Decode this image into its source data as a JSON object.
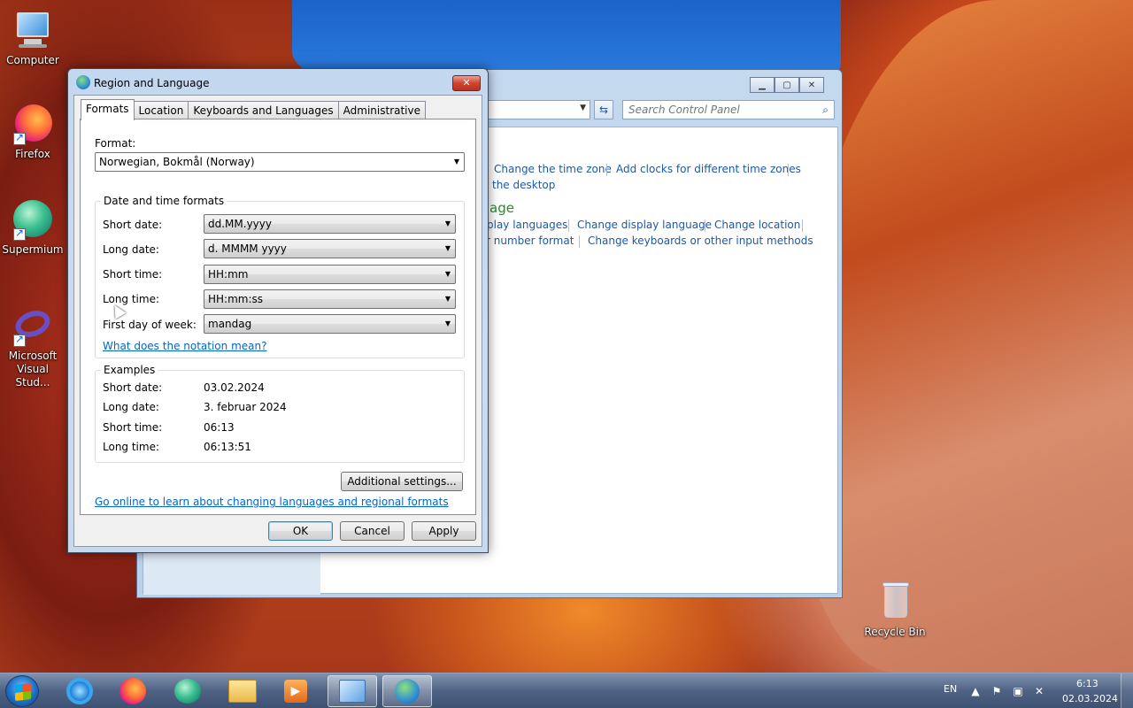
{
  "desktop": {
    "icons": [
      {
        "label": "Computer"
      },
      {
        "label": "Firefox"
      },
      {
        "label": "Supermium"
      },
      {
        "label": "Microsoft Visual Stud..."
      },
      {
        "label": "Recycle Bin"
      }
    ]
  },
  "control_panel": {
    "search_placeholder": "Search Control Panel",
    "links": {
      "change_time_zone": "Change the time zone",
      "add_clocks": "Add clocks for different time zones",
      "desktop_gadget": "the desktop",
      "heading_partial": "age",
      "display_languages_partial": "play languages",
      "change_display_language": "Change display language",
      "change_location": "Change location",
      "number_format_partial": "r number format",
      "change_keyboards": "Change keyboards or other input methods"
    }
  },
  "dialog": {
    "title": "Region and Language",
    "close_glyph": "✕",
    "tabs": [
      "Formats",
      "Location",
      "Keyboards and Languages",
      "Administrative"
    ],
    "active_tab": "Formats",
    "format_label": "Format:",
    "format_value": "Norwegian, Bokmål (Norway)",
    "datetime_group_title": "Date and time formats",
    "fields": [
      {
        "label": "Short date:",
        "value": "dd.MM.yyyy"
      },
      {
        "label": "Long date:",
        "value": "d. MMMM yyyy"
      },
      {
        "label": "Short time:",
        "value": "HH:mm"
      },
      {
        "label": "Long time:",
        "value": "HH:mm:ss"
      },
      {
        "label": "First day of week:",
        "value": "mandag"
      }
    ],
    "notation_link": "What does the notation mean?",
    "examples_group_title": "Examples",
    "examples": [
      {
        "label": "Short date:",
        "value": "03.02.2024"
      },
      {
        "label": "Long date:",
        "value": "3. februar 2024"
      },
      {
        "label": "Short time:",
        "value": "06:13"
      },
      {
        "label": "Long time:",
        "value": "06:13:51"
      }
    ],
    "additional_settings": "Additional settings...",
    "online_link": "Go online to learn about changing languages and regional formats",
    "ok": "OK",
    "cancel": "Cancel",
    "apply": "Apply"
  },
  "taskbar": {
    "language": "EN",
    "time": "6:13",
    "date": "02.03.2024"
  }
}
